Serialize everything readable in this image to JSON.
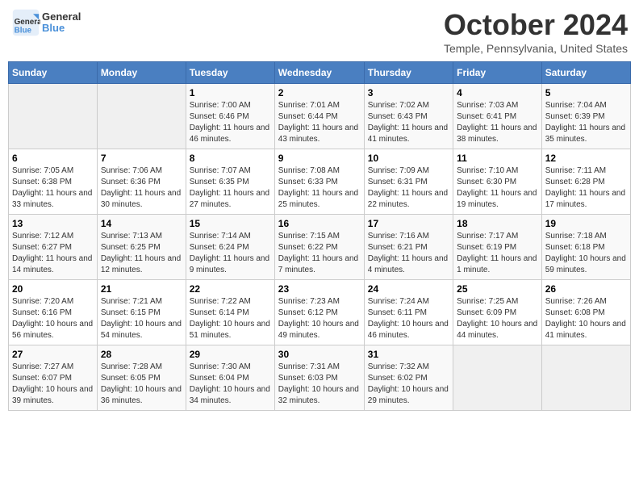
{
  "header": {
    "logo_general": "General",
    "logo_blue": "Blue",
    "month_title": "October 2024",
    "location": "Temple, Pennsylvania, United States"
  },
  "days_of_week": [
    "Sunday",
    "Monday",
    "Tuesday",
    "Wednesday",
    "Thursday",
    "Friday",
    "Saturday"
  ],
  "weeks": [
    [
      {
        "num": "",
        "sunrise": "",
        "sunset": "",
        "daylight": ""
      },
      {
        "num": "",
        "sunrise": "",
        "sunset": "",
        "daylight": ""
      },
      {
        "num": "1",
        "sunrise": "Sunrise: 7:00 AM",
        "sunset": "Sunset: 6:46 PM",
        "daylight": "Daylight: 11 hours and 46 minutes."
      },
      {
        "num": "2",
        "sunrise": "Sunrise: 7:01 AM",
        "sunset": "Sunset: 6:44 PM",
        "daylight": "Daylight: 11 hours and 43 minutes."
      },
      {
        "num": "3",
        "sunrise": "Sunrise: 7:02 AM",
        "sunset": "Sunset: 6:43 PM",
        "daylight": "Daylight: 11 hours and 41 minutes."
      },
      {
        "num": "4",
        "sunrise": "Sunrise: 7:03 AM",
        "sunset": "Sunset: 6:41 PM",
        "daylight": "Daylight: 11 hours and 38 minutes."
      },
      {
        "num": "5",
        "sunrise": "Sunrise: 7:04 AM",
        "sunset": "Sunset: 6:39 PM",
        "daylight": "Daylight: 11 hours and 35 minutes."
      }
    ],
    [
      {
        "num": "6",
        "sunrise": "Sunrise: 7:05 AM",
        "sunset": "Sunset: 6:38 PM",
        "daylight": "Daylight: 11 hours and 33 minutes."
      },
      {
        "num": "7",
        "sunrise": "Sunrise: 7:06 AM",
        "sunset": "Sunset: 6:36 PM",
        "daylight": "Daylight: 11 hours and 30 minutes."
      },
      {
        "num": "8",
        "sunrise": "Sunrise: 7:07 AM",
        "sunset": "Sunset: 6:35 PM",
        "daylight": "Daylight: 11 hours and 27 minutes."
      },
      {
        "num": "9",
        "sunrise": "Sunrise: 7:08 AM",
        "sunset": "Sunset: 6:33 PM",
        "daylight": "Daylight: 11 hours and 25 minutes."
      },
      {
        "num": "10",
        "sunrise": "Sunrise: 7:09 AM",
        "sunset": "Sunset: 6:31 PM",
        "daylight": "Daylight: 11 hours and 22 minutes."
      },
      {
        "num": "11",
        "sunrise": "Sunrise: 7:10 AM",
        "sunset": "Sunset: 6:30 PM",
        "daylight": "Daylight: 11 hours and 19 minutes."
      },
      {
        "num": "12",
        "sunrise": "Sunrise: 7:11 AM",
        "sunset": "Sunset: 6:28 PM",
        "daylight": "Daylight: 11 hours and 17 minutes."
      }
    ],
    [
      {
        "num": "13",
        "sunrise": "Sunrise: 7:12 AM",
        "sunset": "Sunset: 6:27 PM",
        "daylight": "Daylight: 11 hours and 14 minutes."
      },
      {
        "num": "14",
        "sunrise": "Sunrise: 7:13 AM",
        "sunset": "Sunset: 6:25 PM",
        "daylight": "Daylight: 11 hours and 12 minutes."
      },
      {
        "num": "15",
        "sunrise": "Sunrise: 7:14 AM",
        "sunset": "Sunset: 6:24 PM",
        "daylight": "Daylight: 11 hours and 9 minutes."
      },
      {
        "num": "16",
        "sunrise": "Sunrise: 7:15 AM",
        "sunset": "Sunset: 6:22 PM",
        "daylight": "Daylight: 11 hours and 7 minutes."
      },
      {
        "num": "17",
        "sunrise": "Sunrise: 7:16 AM",
        "sunset": "Sunset: 6:21 PM",
        "daylight": "Daylight: 11 hours and 4 minutes."
      },
      {
        "num": "18",
        "sunrise": "Sunrise: 7:17 AM",
        "sunset": "Sunset: 6:19 PM",
        "daylight": "Daylight: 11 hours and 1 minute."
      },
      {
        "num": "19",
        "sunrise": "Sunrise: 7:18 AM",
        "sunset": "Sunset: 6:18 PM",
        "daylight": "Daylight: 10 hours and 59 minutes."
      }
    ],
    [
      {
        "num": "20",
        "sunrise": "Sunrise: 7:20 AM",
        "sunset": "Sunset: 6:16 PM",
        "daylight": "Daylight: 10 hours and 56 minutes."
      },
      {
        "num": "21",
        "sunrise": "Sunrise: 7:21 AM",
        "sunset": "Sunset: 6:15 PM",
        "daylight": "Daylight: 10 hours and 54 minutes."
      },
      {
        "num": "22",
        "sunrise": "Sunrise: 7:22 AM",
        "sunset": "Sunset: 6:14 PM",
        "daylight": "Daylight: 10 hours and 51 minutes."
      },
      {
        "num": "23",
        "sunrise": "Sunrise: 7:23 AM",
        "sunset": "Sunset: 6:12 PM",
        "daylight": "Daylight: 10 hours and 49 minutes."
      },
      {
        "num": "24",
        "sunrise": "Sunrise: 7:24 AM",
        "sunset": "Sunset: 6:11 PM",
        "daylight": "Daylight: 10 hours and 46 minutes."
      },
      {
        "num": "25",
        "sunrise": "Sunrise: 7:25 AM",
        "sunset": "Sunset: 6:09 PM",
        "daylight": "Daylight: 10 hours and 44 minutes."
      },
      {
        "num": "26",
        "sunrise": "Sunrise: 7:26 AM",
        "sunset": "Sunset: 6:08 PM",
        "daylight": "Daylight: 10 hours and 41 minutes."
      }
    ],
    [
      {
        "num": "27",
        "sunrise": "Sunrise: 7:27 AM",
        "sunset": "Sunset: 6:07 PM",
        "daylight": "Daylight: 10 hours and 39 minutes."
      },
      {
        "num": "28",
        "sunrise": "Sunrise: 7:28 AM",
        "sunset": "Sunset: 6:05 PM",
        "daylight": "Daylight: 10 hours and 36 minutes."
      },
      {
        "num": "29",
        "sunrise": "Sunrise: 7:30 AM",
        "sunset": "Sunset: 6:04 PM",
        "daylight": "Daylight: 10 hours and 34 minutes."
      },
      {
        "num": "30",
        "sunrise": "Sunrise: 7:31 AM",
        "sunset": "Sunset: 6:03 PM",
        "daylight": "Daylight: 10 hours and 32 minutes."
      },
      {
        "num": "31",
        "sunrise": "Sunrise: 7:32 AM",
        "sunset": "Sunset: 6:02 PM",
        "daylight": "Daylight: 10 hours and 29 minutes."
      },
      {
        "num": "",
        "sunrise": "",
        "sunset": "",
        "daylight": ""
      },
      {
        "num": "",
        "sunrise": "",
        "sunset": "",
        "daylight": ""
      }
    ]
  ]
}
